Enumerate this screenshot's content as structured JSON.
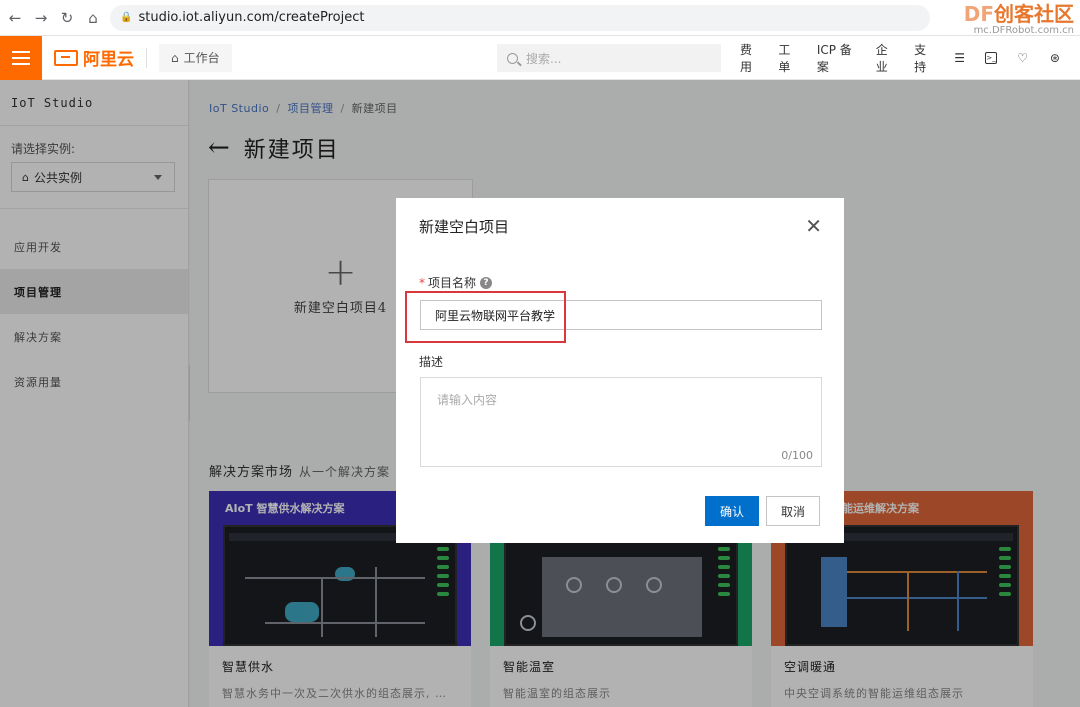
{
  "browser": {
    "url": "studio.iot.aliyun.com/createProject",
    "watermark_prefix": "DF",
    "watermark_title": "创客社区",
    "watermark_sub": "mc.DFRobot.com.cn"
  },
  "header": {
    "logo_text": "阿里云",
    "workbench_label": "工作台",
    "search_placeholder": "搜索...",
    "links": [
      "费用",
      "工单",
      "ICP 备案",
      "企业",
      "支持"
    ],
    "icons": [
      "app-icon",
      "terminal-icon",
      "bell-icon",
      "cart-icon"
    ],
    "accent_color": "#ff6a00"
  },
  "sidebar": {
    "title": "IoT Studio",
    "instance_label": "请选择实例:",
    "instance_value": "公共实例",
    "items": [
      {
        "label": "应用开发",
        "active": false
      },
      {
        "label": "项目管理",
        "active": true
      },
      {
        "label": "解决方案",
        "active": false
      },
      {
        "label": "资源用量",
        "active": false
      }
    ]
  },
  "breadcrumb": [
    "IoT Studio",
    "项目管理",
    "新建项目"
  ],
  "page_title": "新建项目",
  "new_card_label": "新建空白项目4",
  "market": {
    "title": "解决方案市场",
    "subtitle": "从一个解决方案",
    "cards": [
      {
        "banner": "AIoT 智慧供水解决方案",
        "name": "智慧供水",
        "desc": "智慧水务中一次及二次供水的组态展示, …",
        "color": "#3d2fb8"
      },
      {
        "banner": "",
        "name": "智能温室",
        "desc": "智能温室的组态展示",
        "color": "#1aa86b"
      },
      {
        "banner": "智能运维解决方案",
        "name": "空调暖通",
        "desc": "中央空调系统的智能运维组态展示",
        "color": "#e0683a"
      }
    ]
  },
  "modal": {
    "title": "新建空白项目",
    "name_label": "项目名称",
    "name_value": "阿里云物联网平台教学",
    "desc_label": "描述",
    "desc_placeholder": "请输入内容",
    "desc_count": "0/100",
    "ok_label": "确认",
    "cancel_label": "取消",
    "primary_color": "#0070cc",
    "highlight_color": "#d9363e"
  }
}
